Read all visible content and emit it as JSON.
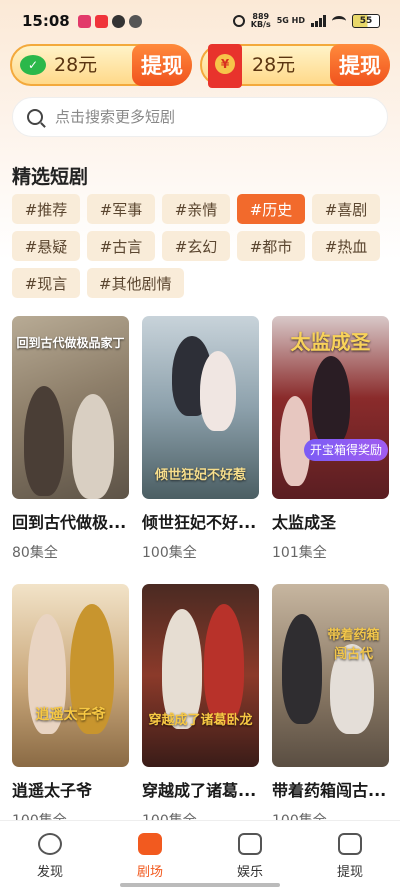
{
  "status_bar": {
    "time": "15:08",
    "network_speed": "889",
    "network_unit": "KB/s",
    "signal_label": "5G HD",
    "battery": "55"
  },
  "cash": {
    "left_amount": "28元",
    "right_amount": "28元",
    "withdraw_label": "提现"
  },
  "search": {
    "placeholder": "点击搜索更多短剧"
  },
  "section_title": "精选短剧",
  "tags": [
    [
      "#推荐",
      "#军事",
      "#亲情",
      "#历史",
      "#喜剧"
    ],
    [
      "#悬疑",
      "#古言",
      "#玄幻",
      "#都市",
      "#热血"
    ],
    [
      "#现言",
      "#其他剧情"
    ]
  ],
  "active_tag": "#历史",
  "dramas": [
    {
      "title": "回到古代做极...",
      "episodes": "80集全",
      "poster_text": "回到古代做极品家丁"
    },
    {
      "title": "倾世狂妃不好...",
      "episodes": "100集全",
      "poster_text": "倾世狂妃不好惹"
    },
    {
      "title": "太监成圣",
      "episodes": "101集全",
      "poster_text": "太监成圣",
      "badge": "开宝箱得奖励"
    },
    {
      "title": "逍遥太子爷",
      "episodes": "100集全",
      "poster_text": "逍遥太子爷"
    },
    {
      "title": "穿越成了诸葛...",
      "episodes": "100集全",
      "poster_text": "穿越成了诸葛卧龙"
    },
    {
      "title": "带着药箱闯古...",
      "episodes": "100集全",
      "poster_text": "带着药箱闯古代"
    }
  ],
  "nav": [
    {
      "label": "发现",
      "icon": "discover-icon"
    },
    {
      "label": "剧场",
      "icon": "theater-icon"
    },
    {
      "label": "娱乐",
      "icon": "entertainment-icon"
    },
    {
      "label": "提现",
      "icon": "withdraw-icon"
    }
  ],
  "active_nav": "剧场",
  "colors": {
    "accent": "#f26a2c",
    "tag_bg": "#f9ecd9",
    "reward_badge": "#8a5cf3"
  }
}
